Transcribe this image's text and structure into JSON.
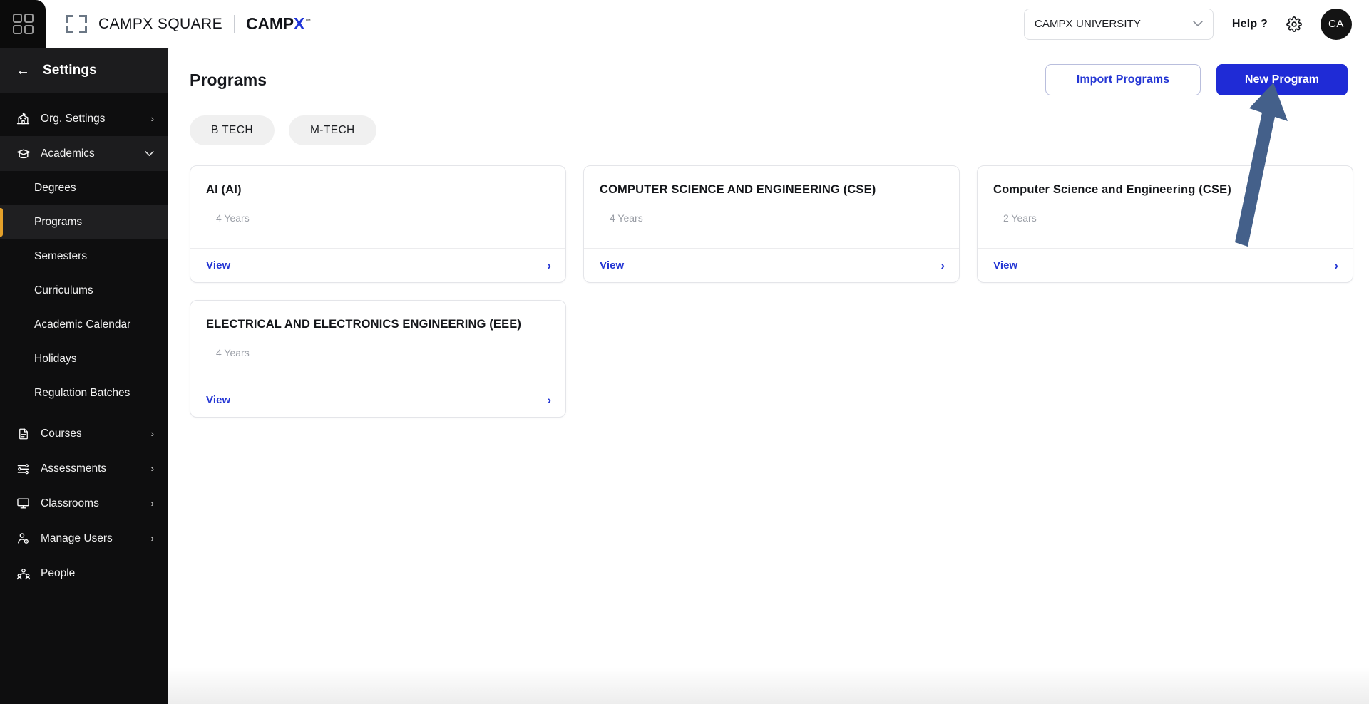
{
  "topbar": {
    "logo_icon": "four-squares-logo-icon",
    "bracket_icon": "square-bracket-icon",
    "brand_title": "CAMPX SQUARE",
    "brand_secondary": "CAMP",
    "brand_secondary_accent": "X",
    "brand_trademark": "™",
    "org_select_value": "CAMPX UNIVERSITY",
    "org_select_chevron": "chevron-down-icon",
    "help_label": "Help ?",
    "settings_icon": "gear-icon",
    "avatar_initials": "CA"
  },
  "sidebar": {
    "back_icon": "←",
    "title": "Settings",
    "items": [
      {
        "label": "Org. Settings",
        "icon": "school-building-icon",
        "caret": "›",
        "type": "parent"
      },
      {
        "label": "Academics",
        "icon": "graduation-cap-icon",
        "caret": "⌄",
        "type": "parent",
        "expanded": true
      },
      {
        "label": "Degrees",
        "type": "child"
      },
      {
        "label": "Programs",
        "type": "child",
        "active": true
      },
      {
        "label": "Semesters",
        "type": "child"
      },
      {
        "label": "Curriculums",
        "type": "child"
      },
      {
        "label": "Academic Calendar",
        "type": "child"
      },
      {
        "label": "Holidays",
        "type": "child"
      },
      {
        "label": "Regulation Batches",
        "type": "child"
      },
      {
        "label": "Courses",
        "icon": "document-icon",
        "caret": "›",
        "type": "parent"
      },
      {
        "label": "Assessments",
        "icon": "sliders-icon",
        "caret": "›",
        "type": "parent"
      },
      {
        "label": "Classrooms",
        "icon": "monitor-icon",
        "caret": "›",
        "type": "parent"
      },
      {
        "label": "Manage Users",
        "icon": "user-settings-icon",
        "caret": "›",
        "type": "parent"
      },
      {
        "label": "People",
        "icon": "people-group-icon",
        "type": "parent"
      }
    ]
  },
  "main": {
    "page_title": "Programs",
    "import_button": "Import Programs",
    "new_button": "New Program",
    "chips": [
      {
        "label": "B TECH"
      },
      {
        "label": "M-TECH"
      }
    ],
    "view_label": "View",
    "view_arrow": "›",
    "cards": [
      {
        "title": "AI (AI)",
        "duration": "4 Years"
      },
      {
        "title": "COMPUTER SCIENCE AND ENGINEERING (CSE)",
        "duration": "4 Years"
      },
      {
        "title": "Computer Science and Engineering (CSE)",
        "duration": "2 Years"
      },
      {
        "title": "ELECTRICAL AND ELECTRONICS ENGINEERING (EEE)",
        "duration": "4 Years"
      }
    ]
  },
  "annotation": {
    "arrow_icon": "up-arrow-annotation-icon",
    "color": "#44608a",
    "points_to": "New Program"
  },
  "colors": {
    "primary_blue": "#1f2bd6",
    "link_blue": "#2436d4",
    "sidebar_bg": "#0e0e0f",
    "sidebar_active_accent": "#e5a12a",
    "chip_bg": "#f0f0f0",
    "annotation": "#44608a"
  }
}
